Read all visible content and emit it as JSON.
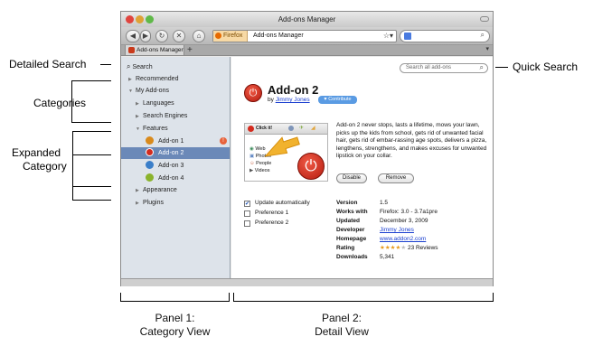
{
  "window": {
    "title": "Add-ons Manager",
    "url_site": "Firefox",
    "url_path": "Add-ons Manager",
    "tab_label": "Add-ons Manager"
  },
  "callouts": {
    "detailed_search": "Detailed Search",
    "categories": "Categories",
    "expanded_category_1": "Expanded",
    "expanded_category_2": "Category",
    "quick_search": "Quick Search",
    "panel1_line1": "Panel 1:",
    "panel1_line2": "Category View",
    "panel2_line1": "Panel 2:",
    "panel2_line2": "Detail View"
  },
  "sidebar": {
    "search": "Search",
    "recommended": "Recommended",
    "my_addons": "My Add-ons",
    "languages": "Languages",
    "search_engines": "Search Engines",
    "features": "Features",
    "addons": [
      "Add-on 1",
      "Add-on 2",
      "Add-on 3",
      "Add-on 4"
    ],
    "appearance": "Appearance",
    "plugins": "Plugins"
  },
  "detail": {
    "quick_search_placeholder": "Search all add-ons",
    "name": "Add-on 2",
    "by": "by",
    "author": "Jimmy Jones",
    "contribute": "Contribute",
    "description": "Add-on 2 never stops, lasts a lifetime, mows your lawn, picks up the kids from school, gets rid of unwanted facial hair, gets rid of embar-rassing age spots, delivers a pizza, lengthens, strengthens, and makes excuses for unwanted lipstick on your collar.",
    "disable": "Disable",
    "remove": "Remove",
    "preview": {
      "click_it": "Click it!",
      "menu": [
        "Web",
        "Photos",
        "People",
        "Videos"
      ]
    },
    "prefs": [
      {
        "label": "Update automatically",
        "checked": true
      },
      {
        "label": "Preference 1",
        "checked": false
      },
      {
        "label": "Preference 2",
        "checked": false
      }
    ],
    "info": [
      {
        "key": "Version",
        "value": "1.5"
      },
      {
        "key": "Works with",
        "value": "Firefox: 3.0 - 3.7a1pre"
      },
      {
        "key": "Updated",
        "value": "December 3, 2009"
      },
      {
        "key": "Developer",
        "value": "Jimmy Jones"
      },
      {
        "key": "Homepage",
        "value": "www.addon2.com"
      },
      {
        "key": "Rating",
        "value": "23 Reviews"
      },
      {
        "key": "Downloads",
        "value": "5,341"
      }
    ],
    "rating_stars": 4
  },
  "colors": {
    "selection": "#6b89b8",
    "link": "#1a3fcf",
    "sidebar_bg": "#dde3ea"
  }
}
